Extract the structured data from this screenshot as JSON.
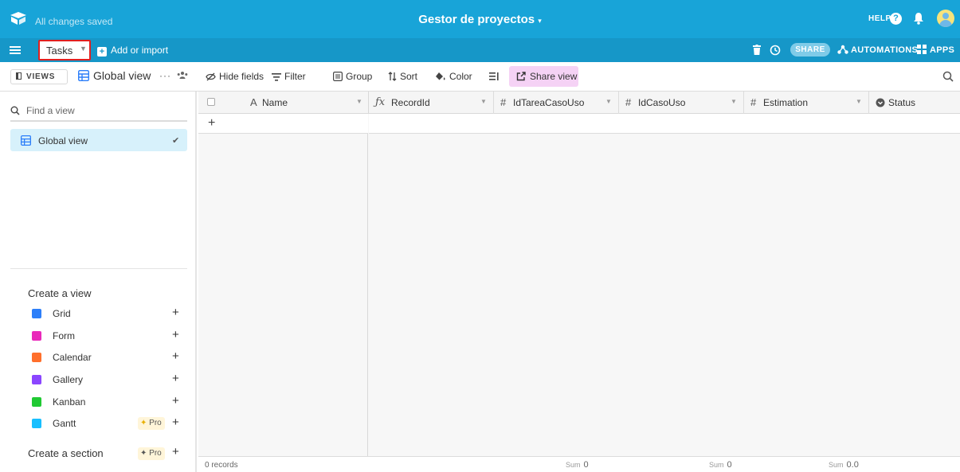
{
  "header": {
    "saved_status": "All changes saved",
    "base_title": "Gestor de proyectos",
    "help_label": "HELP"
  },
  "tablebar": {
    "active_table": "Tasks",
    "add_import": "Add or import",
    "share_label": "SHARE",
    "automations_label": "AUTOMATIONS",
    "apps_label": "APPS"
  },
  "toolbar": {
    "views_label": "VIEWS",
    "view_name": "Global view",
    "more": "···",
    "hide_fields": "Hide fields",
    "filter": "Filter",
    "group": "Group",
    "sort": "Sort",
    "color": "Color",
    "share_view": "Share view"
  },
  "sidebar": {
    "find_placeholder": "Find a view",
    "active_view": "Global view",
    "create_title": "Create a view",
    "create_items": [
      {
        "label": "Grid",
        "color": "#2d7ff9"
      },
      {
        "label": "Form",
        "color": "#e929ba"
      },
      {
        "label": "Calendar",
        "color": "#ff6f2c"
      },
      {
        "label": "Gallery",
        "color": "#8b46ff"
      },
      {
        "label": "Kanban",
        "color": "#20c933"
      },
      {
        "label": "Gantt",
        "color": "#18bfff",
        "pro": "Pro"
      }
    ],
    "section_label": "Create a section",
    "section_pro": "Pro"
  },
  "grid": {
    "columns": [
      {
        "icon": "A",
        "name": "Name"
      },
      {
        "icon": "fx",
        "name": "RecordId"
      },
      {
        "icon": "#",
        "name": "IdTareaCasoUso"
      },
      {
        "icon": "#",
        "name": "IdCasoUso"
      },
      {
        "icon": "#",
        "name": "Estimation"
      },
      {
        "icon": "status",
        "name": "Status"
      }
    ],
    "footer": {
      "records": "0 records",
      "sum_label": "Sum",
      "sums": [
        "0",
        "0",
        "0.0"
      ]
    }
  },
  "colors": {
    "header_bg": "#18a4d8",
    "tablebar_bg": "#1697c8",
    "share_view_bg": "#f5d2f5",
    "active_view_bg": "#d7f1fb"
  }
}
